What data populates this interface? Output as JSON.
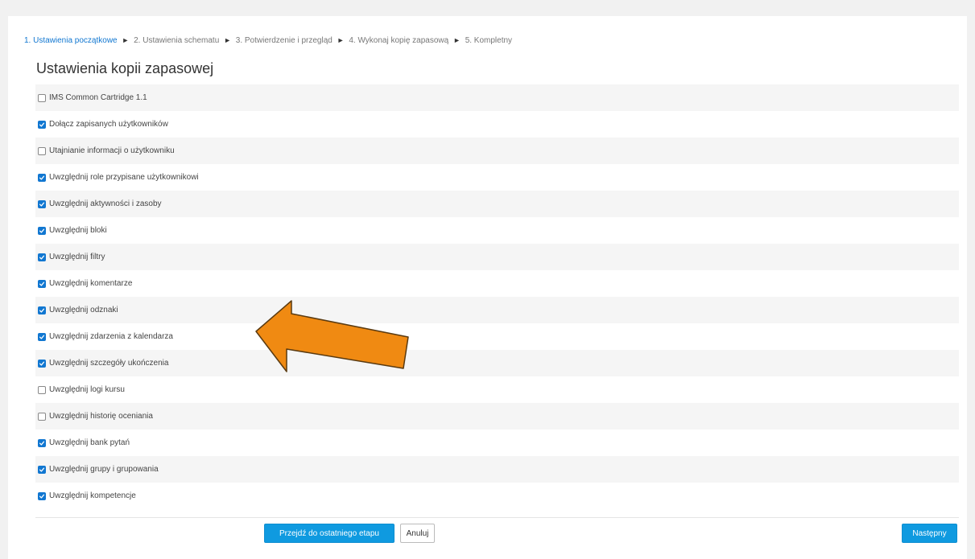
{
  "progress": {
    "steps": [
      "1. Ustawienia początkowe",
      "2. Ustawienia schematu",
      "3. Potwierdzenie i przegląd",
      "4. Wykonaj kopię zapasową",
      "5. Kompletny"
    ],
    "separator": "►"
  },
  "heading": "Ustawienia kopii zapasowej",
  "settings": [
    {
      "label": "IMS Common Cartridge 1.1",
      "checked": false
    },
    {
      "label": "Dołącz zapisanych użytkowników",
      "checked": true
    },
    {
      "label": "Utajnianie informacji o użytkowniku",
      "checked": false
    },
    {
      "label": "Uwzględnij role przypisane użytkownikowi",
      "checked": true
    },
    {
      "label": "Uwzględnij aktywności i zasoby",
      "checked": true
    },
    {
      "label": "Uwzględnij bloki",
      "checked": true
    },
    {
      "label": "Uwzględnij filtry",
      "checked": true
    },
    {
      "label": "Uwzględnij komentarze",
      "checked": true
    },
    {
      "label": "Uwzględnij odznaki",
      "checked": true
    },
    {
      "label": "Uwzględnij zdarzenia z kalendarza",
      "checked": true
    },
    {
      "label": "Uwzględnij szczegóły ukończenia",
      "checked": true
    },
    {
      "label": "Uwzględnij logi kursu",
      "checked": false
    },
    {
      "label": "Uwzględnij historię oceniania",
      "checked": false
    },
    {
      "label": "Uwzględnij bank pytań",
      "checked": true
    },
    {
      "label": "Uwzględnij grupy i grupowania",
      "checked": true
    },
    {
      "label": "Uwzględnij kompetencje",
      "checked": true
    }
  ],
  "buttons": {
    "skip_to_final": "Przejdź do ostatniego etapu",
    "cancel": "Anuluj",
    "next": "Następny"
  },
  "colors": {
    "primary": "#0f9ae0",
    "checkbox": "#1177d1",
    "annotation_arrow": "#f08a12"
  },
  "icons": {
    "checkbox_checked": "check-icon",
    "annotation": "arrow-icon"
  }
}
